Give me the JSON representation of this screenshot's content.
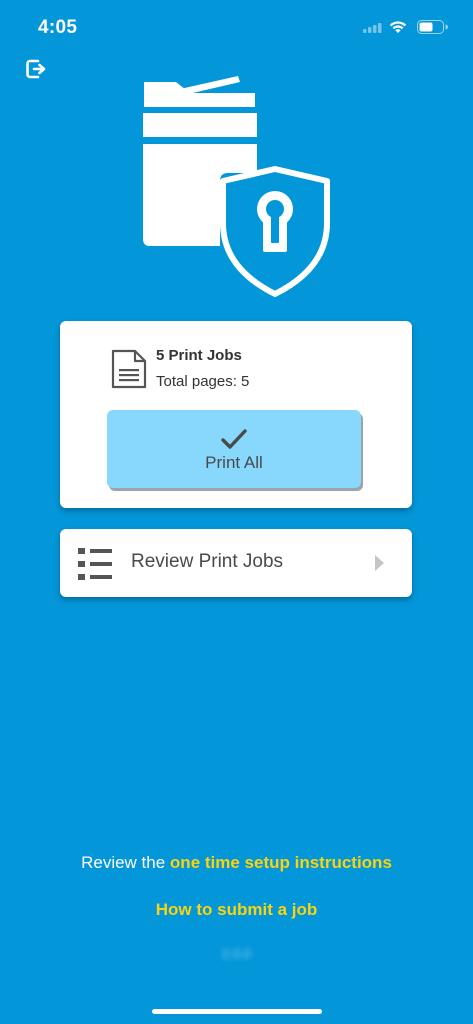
{
  "status_bar": {
    "time": "4:05",
    "icons": [
      "cellular-signal-icon",
      "wifi-icon",
      "battery-icon"
    ]
  },
  "header": {
    "logout_icon": "logout-icon"
  },
  "hero": {
    "icon": "secure-printer-icon"
  },
  "summary": {
    "jobs_title": "5 Print Jobs",
    "total_pages": "Total pages: 5",
    "print_all_label": "Print All"
  },
  "review": {
    "label": "Review Print Jobs"
  },
  "footer": {
    "prefix": "Review the ",
    "setup_link": "one time setup instructions",
    "submit_link": "How to submit a job",
    "version": "2.0.0"
  },
  "colors": {
    "background": "#0396d8",
    "card": "#ffffff",
    "print_button": "#87d8fc",
    "link": "#f9d411"
  }
}
